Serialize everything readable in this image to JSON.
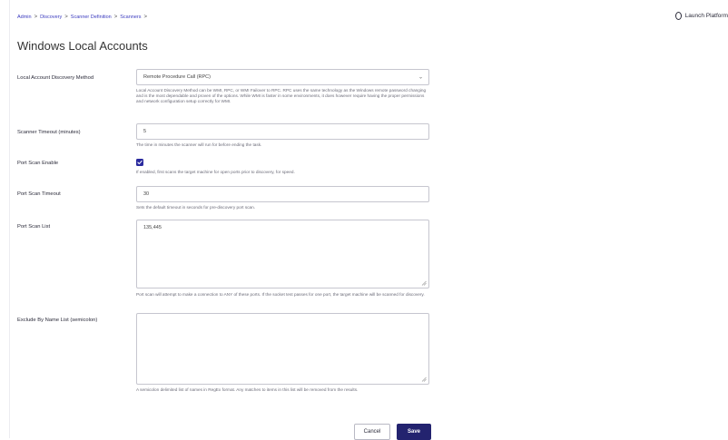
{
  "breadcrumb": {
    "items": [
      "Admin",
      "Discovery",
      "Scanner Definition",
      "Scanners"
    ],
    "separator": ">"
  },
  "header": {
    "launch_label": "Launch Platform"
  },
  "page": {
    "title": "Windows Local Accounts"
  },
  "form": {
    "discovery_method": {
      "label": "Local Account Discovery Method",
      "value": "Remote Procedure Call (RPC)",
      "help": "Local Account Discovery Method can be WMI, RPC, or WMI Failover to RPC. RPC uses the same technology as the Windows remote password changing and is the most dependable and proven of the options. While WMI is faster in some environments, it does however require having the proper permissions and network configuration setup correctly for WMI."
    },
    "scanner_timeout": {
      "label": "Scanner Timeout (minutes)",
      "value": "5",
      "help": "The time in minutes the scanner will run for before ending the task."
    },
    "port_scan_enable": {
      "label": "Port Scan Enable",
      "checked": true,
      "help": "If enabled, first scans the target machine for open ports prior to discovery, for speed."
    },
    "port_scan_timeout": {
      "label": "Port Scan Timeout",
      "value": "30",
      "help": "Sets the default timeout in seconds for pre-discovery port scan."
    },
    "port_scan_list": {
      "label": "Port Scan List",
      "value": "135,445",
      "help": "Port scan will attempt to make a connection to ANY of these ports. If the socket test passes for one port, the target machine will be scanned for discovery."
    },
    "exclude_by_name": {
      "label": "Exclude By Name List (semicolon)",
      "value": "",
      "help": "A semicolon delimited list of names in RegEx format. Any matches to items in this list will be removed from the results."
    }
  },
  "actions": {
    "cancel_label": "Cancel",
    "save_label": "Save"
  },
  "colors": {
    "accent": "#23236f",
    "checkbox": "#2a2a9e",
    "link": "#3b3bbf"
  }
}
